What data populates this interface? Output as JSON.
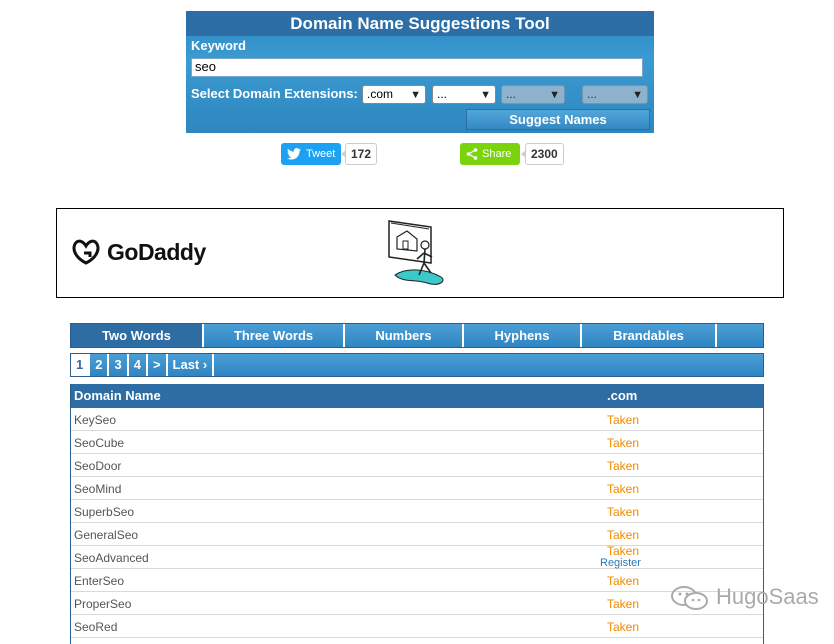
{
  "tool": {
    "title": "Domain Name Suggestions Tool",
    "keyword_label": "Keyword",
    "keyword_value": "seo",
    "extensions_label": "Select Domain Extensions:",
    "extensions": [
      ".com",
      "...",
      "...",
      "..."
    ],
    "suggest_button": "Suggest Names"
  },
  "share": {
    "tweet_label": "Tweet",
    "tweet_count": "172",
    "share_label": "Share",
    "share_count": "2300"
  },
  "ad": {
    "brand": "GoDaddy"
  },
  "tabs": [
    "Two Words",
    "Three Words",
    "Numbers",
    "Hyphens",
    "Brandables"
  ],
  "pager": [
    "1",
    "2",
    "3",
    "4",
    ">",
    "Last ›"
  ],
  "table": {
    "headers": [
      "Domain Name",
      ".com"
    ],
    "rows": [
      {
        "name": "KeySeo",
        "status": "Taken"
      },
      {
        "name": "SeoCube",
        "status": "Taken"
      },
      {
        "name": "SeoDoor",
        "status": "Taken"
      },
      {
        "name": "SeoMind",
        "status": "Taken"
      },
      {
        "name": "SuperbSeo",
        "status": "Taken"
      },
      {
        "name": "GeneralSeo",
        "status": "Taken"
      },
      {
        "name": "SeoAdvanced",
        "status": "Taken",
        "status2": "Register"
      },
      {
        "name": "EnterSeo",
        "status": "Taken"
      },
      {
        "name": "ProperSeo",
        "status": "Taken"
      },
      {
        "name": "SeoRed",
        "status": "Taken"
      }
    ]
  },
  "watermark": "HugoSaas",
  "colors": {
    "header_blue": "#2e6da4",
    "taken_orange": "#f08a00",
    "tweet_blue": "#1da1f2",
    "share_green": "#7ad30d"
  }
}
